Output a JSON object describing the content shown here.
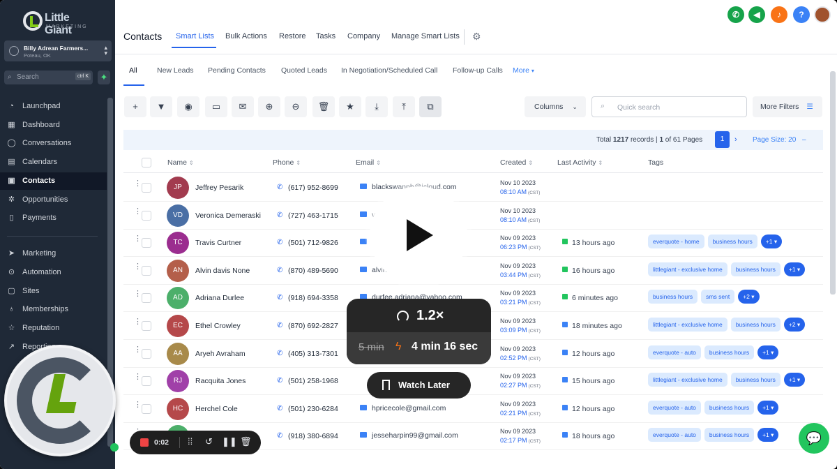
{
  "brand": {
    "name": "Little Giant",
    "sub": "MARKETING"
  },
  "account": {
    "name": "Billy Adrean Farmers...",
    "location": "Poteau, OK"
  },
  "search": {
    "placeholder": "Search",
    "shortcut": "ctrl K"
  },
  "sidebar": {
    "items": [
      {
        "label": "Launchpad",
        "icon": "rocket-icon"
      },
      {
        "label": "Dashboard",
        "icon": "grid-icon"
      },
      {
        "label": "Conversations",
        "icon": "chat-icon"
      },
      {
        "label": "Calendars",
        "icon": "calendar-icon"
      },
      {
        "label": "Contacts",
        "icon": "contacts-icon",
        "active": true
      },
      {
        "label": "Opportunities",
        "icon": "funnel-icon"
      },
      {
        "label": "Payments",
        "icon": "receipt-icon"
      },
      {
        "label": "Marketing",
        "icon": "send-icon"
      },
      {
        "label": "Automation",
        "icon": "automation-icon"
      },
      {
        "label": "Sites",
        "icon": "globe-icon"
      },
      {
        "label": "Memberships",
        "icon": "badge-icon"
      },
      {
        "label": "Reputation",
        "icon": "star-icon"
      },
      {
        "label": "Reporting",
        "icon": "chart-icon"
      }
    ]
  },
  "header": {
    "title": "Contacts",
    "tabs": [
      "Smart Lists",
      "Bulk Actions",
      "Restore",
      "Tasks",
      "Company",
      "Manage Smart Lists"
    ]
  },
  "subtabs": [
    "All",
    "New Leads",
    "Pending Contacts",
    "Quoted Leads",
    "In Negotiation/Scheduled Call",
    "Follow-up Calls",
    "More"
  ],
  "toolbar": {
    "columns_label": "Columns",
    "search_placeholder": "Quick search",
    "more_filters_label": "More Filters"
  },
  "pager": {
    "total_prefix": "Total",
    "total": "1217",
    "records_suffix": "records |",
    "page": "1",
    "of_pages": "of 61 Pages",
    "current_page": "1",
    "page_size": "Page Size: 20"
  },
  "table": {
    "columns": [
      "Name",
      "Phone",
      "Email",
      "Created",
      "Last Activity",
      "Tags"
    ],
    "rows": [
      {
        "initials": "JP",
        "color": "#a23b4f",
        "name": "Jeffrey Pesarik",
        "phone": "(617) 952-8699",
        "email": "blackswannh@icloud.com",
        "date": "Nov 10 2023",
        "time": "08:10 AM",
        "activity": "",
        "tags": [],
        "more": ""
      },
      {
        "initials": "VD",
        "color": "#4a6fa5",
        "name": "Veronica Demeraski",
        "phone": "(727) 463-1715",
        "email": "vi...",
        "date": "Nov 10 2023",
        "time": "08:10 AM",
        "activity": "",
        "tags": [],
        "more": ""
      },
      {
        "initials": "TC",
        "color": "#9b2d8f",
        "name": "Travis Curtner",
        "phone": "(501) 712-9826",
        "email": "f...",
        "date": "Nov 09 2023",
        "time": "06:23 PM",
        "activity": "13 hours ago",
        "act_color": "#22c55e",
        "tags": [
          "everquote - home",
          "business hours"
        ],
        "more": "+1"
      },
      {
        "initials": "AN",
        "color": "#b45f4a",
        "name": "Alvin davis None",
        "phone": "(870) 489-5690",
        "email": "alvind...com",
        "date": "Nov 09 2023",
        "time": "03:44 PM",
        "activity": "16 hours ago",
        "act_color": "#22c55e",
        "tags": [
          "littlegiant - exclusive home",
          "business hours"
        ],
        "more": "+1"
      },
      {
        "initials": "AD",
        "color": "#4caf6a",
        "name": "Adriana Durlee",
        "phone": "(918) 694-3358",
        "email": "durfee.adriana@yahoo.com",
        "date": "Nov 09 2023",
        "time": "03:21 PM",
        "activity": "6 minutes ago",
        "act_color": "#22c55e",
        "tags": [
          "business hours",
          "sms sent"
        ],
        "more": "+2"
      },
      {
        "initials": "EC",
        "color": "#b5484a",
        "name": "Ethel Crowley",
        "phone": "(870) 692-2827",
        "email": "",
        "date": "Nov 09 2023",
        "time": "03:09 PM",
        "activity": "18 minutes ago",
        "act_color": "#3b82f6",
        "tags": [
          "littlegiant - exclusive home",
          "business hours"
        ],
        "more": "+2"
      },
      {
        "initials": "AA",
        "color": "#a88a4a",
        "name": "Aryeh Avraham",
        "phone": "(405) 313-7301",
        "email": "",
        "date": "Nov 09 2023",
        "time": "02:52 PM",
        "activity": "12 hours ago",
        "act_color": "#3b82f6",
        "tags": [
          "everquote - auto",
          "business hours"
        ],
        "more": "+1"
      },
      {
        "initials": "RJ",
        "color": "#a040a8",
        "name": "Racquita Jones",
        "phone": "(501) 258-1968",
        "email": "",
        "date": "Nov 09 2023",
        "time": "02:27 PM",
        "activity": "15 hours ago",
        "act_color": "#3b82f6",
        "tags": [
          "littlegiant - exclusive home",
          "business hours"
        ],
        "more": "+1"
      },
      {
        "initials": "HC",
        "color": "#b5484a",
        "name": "Herchel Cole",
        "phone": "(501) 230-6284",
        "email": "hpricecole@gmail.com",
        "date": "Nov 09 2023",
        "time": "02:21 PM",
        "activity": "12 hours ago",
        "act_color": "#3b82f6",
        "tags": [
          "everquote - auto",
          "business hours"
        ],
        "more": "+1"
      },
      {
        "initials": "",
        "color": "#4caf6a",
        "name": "",
        "phone": "(918) 380-6894",
        "email": "jesseharpin99@gmail.com",
        "date": "Nov 09 2023",
        "time": "02:17 PM",
        "activity": "18 hours ago",
        "act_color": "#3b82f6",
        "tags": [
          "everquote - auto",
          "business hours"
        ],
        "more": "+1"
      }
    ],
    "tz": "CST"
  },
  "player": {
    "speed": "1.2×",
    "old_time": "5 min",
    "new_time": "4 min 16 sec",
    "watch_later": "Watch Later",
    "rec_time": "0:02"
  },
  "colors": {
    "accent": "#2563eb",
    "sidebar": "#1f2937",
    "tag_bg": "#dbeafe"
  }
}
